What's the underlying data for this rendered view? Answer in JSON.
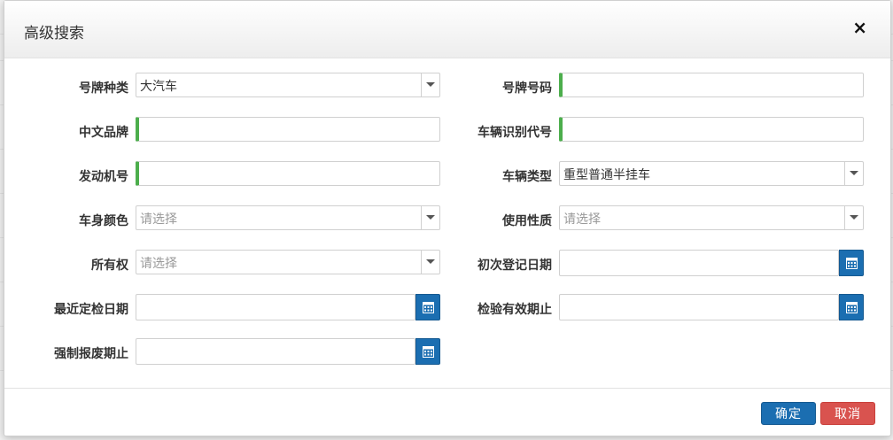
{
  "modal": {
    "title": "高级搜索",
    "close_symbol": "×"
  },
  "fields": {
    "plate_type": {
      "label": "号牌种类",
      "value": "大汽车"
    },
    "plate_number": {
      "label": "号牌号码",
      "value": ""
    },
    "chinese_brand": {
      "label": "中文品牌",
      "value": ""
    },
    "vin": {
      "label": "车辆识别代号",
      "value": ""
    },
    "engine_number": {
      "label": "发动机号",
      "value": ""
    },
    "vehicle_type": {
      "label": "车辆类型",
      "value": "重型普通半挂车"
    },
    "body_color": {
      "label": "车身颜色",
      "placeholder": "请选择"
    },
    "usage_nature": {
      "label": "使用性质",
      "placeholder": "请选择"
    },
    "ownership": {
      "label": "所有权",
      "placeholder": "请选择"
    },
    "first_registration_date": {
      "label": "初次登记日期",
      "value": ""
    },
    "latest_inspection_date": {
      "label": "最近定检日期",
      "value": ""
    },
    "inspection_valid_until": {
      "label": "检验有效期止",
      "value": ""
    },
    "forced_scrap_date": {
      "label": "强制报废期止",
      "value": ""
    }
  },
  "footer": {
    "ok_label": "确定",
    "cancel_label": "取消"
  },
  "colors": {
    "primary": "#1b6eb1",
    "danger": "#d9534f",
    "required": "#4cae4c"
  },
  "icons": {
    "dropdown": "chevron-down-icon",
    "calendar": "calendar-icon",
    "close": "close-icon"
  }
}
